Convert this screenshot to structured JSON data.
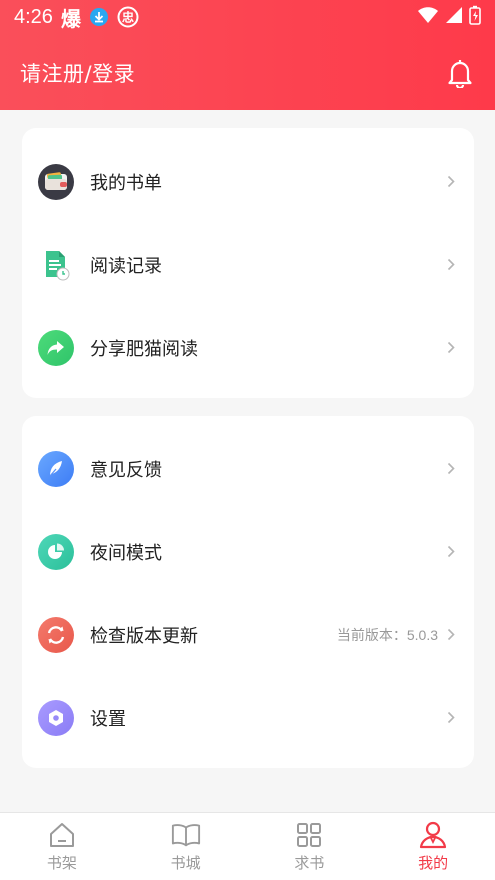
{
  "status_bar": {
    "time": "4:26",
    "notification_glyph": "爆"
  },
  "header": {
    "title": "请注册/登录",
    "bell_icon": "bell-icon"
  },
  "menu_group_1": [
    {
      "label": "我的书单",
      "icon": "wallet-icon"
    },
    {
      "label": "阅读记录",
      "icon": "document-clock-icon"
    },
    {
      "label": "分享肥猫阅读",
      "icon": "share-icon"
    }
  ],
  "menu_group_2": [
    {
      "label": "意见反馈",
      "icon": "feather-icon"
    },
    {
      "label": "夜间模式",
      "icon": "pie-chart-icon"
    },
    {
      "label": "检查版本更新",
      "icon": "refresh-icon",
      "extra": "当前版本：5.0.3"
    },
    {
      "label": "设置",
      "icon": "hexagon-gear-icon"
    }
  ],
  "tabs": [
    {
      "label": "书架",
      "icon": "house-icon",
      "active": false
    },
    {
      "label": "书城",
      "icon": "open-book-icon",
      "active": false
    },
    {
      "label": "求书",
      "icon": "grid-icon",
      "active": false
    },
    {
      "label": "我的",
      "icon": "person-icon",
      "active": true
    }
  ],
  "colors": {
    "header_start": "#fa4f5a",
    "header_end": "#fe3a4a",
    "active_tab": "#f23a48",
    "background": "#f6f6f6"
  }
}
